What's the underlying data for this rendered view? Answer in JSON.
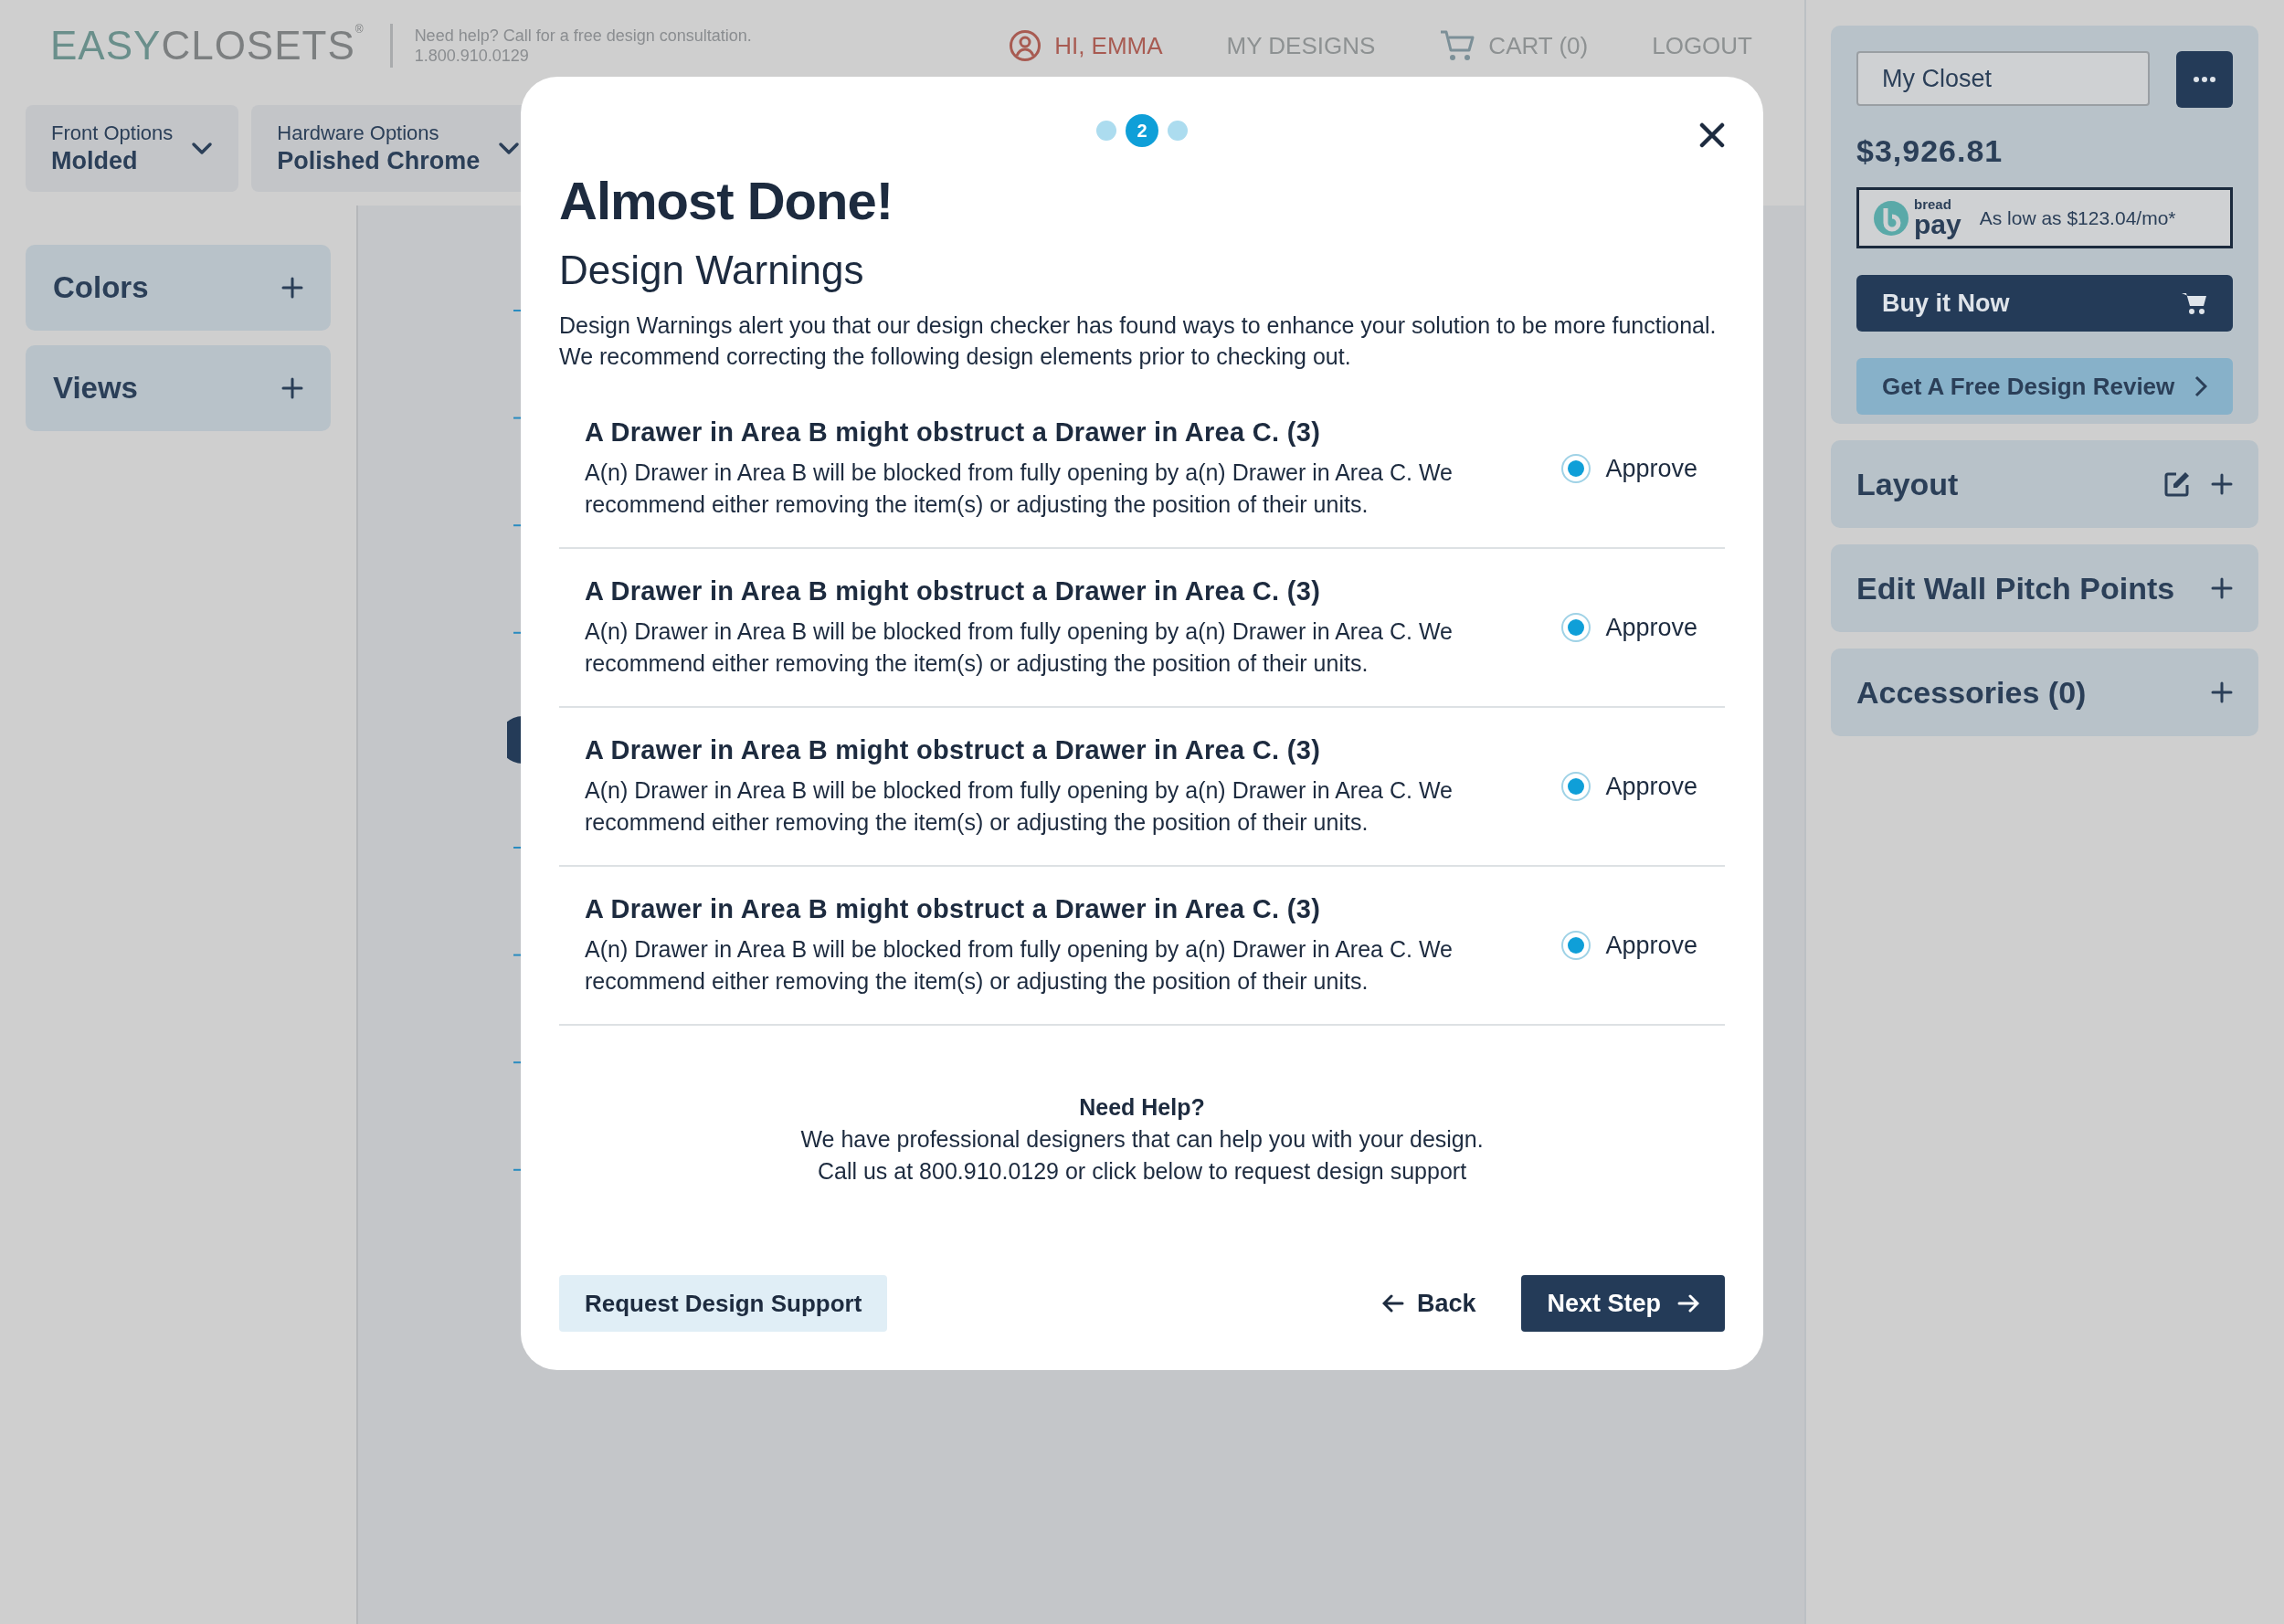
{
  "header": {
    "logo_accent": "EASY",
    "logo_rest": "CLOSETS",
    "logo_mark": "®",
    "tagline": "Need help? Call for a free design consultation.",
    "phone": "1.800.910.0129",
    "nav": [
      {
        "label": "HI, EMMA",
        "kind": "user"
      },
      {
        "label": "MY DESIGNS",
        "kind": "link"
      },
      {
        "label": "CART (0)",
        "kind": "cart"
      },
      {
        "label": "LOGOUT",
        "kind": "link"
      }
    ]
  },
  "options": [
    {
      "label": "Front Options",
      "value": "Molded"
    },
    {
      "label": "Hardware Options",
      "value": "Polished Chrome"
    }
  ],
  "left_panels": [
    "Colors",
    "Views"
  ],
  "summary": {
    "design_name": "My Closet",
    "price": "$3,926.81",
    "financing": {
      "brand_top": "bread",
      "brand": "pay",
      "text": "As low as $123.04/mo*"
    },
    "buy_button": "Buy it Now",
    "review_button": "Get A Free Design Review"
  },
  "right_panels": [
    {
      "label": "Layout",
      "editable": true
    },
    {
      "label": "Edit Wall Pitch Points",
      "editable": false
    },
    {
      "label": "Accessories (0)",
      "editable": false
    }
  ],
  "modal": {
    "steps": [
      {
        "selected": false
      },
      {
        "selected": true,
        "label": "2"
      },
      {
        "selected": false
      }
    ],
    "title": "Almost Done!",
    "subtitle": "Design Warnings",
    "intro": "Design Warnings alert you that our design checker has found ways to enhance your solution to be more functional. We recommend correcting the following design elements prior to checking out.",
    "warnings": [
      {
        "title": "A Drawer in Area B might obstruct a Drawer in Area C. (3)",
        "description": "A(n) Drawer in Area B will be blocked from fully opening by a(n) Drawer in Area C. We recommend either removing the item(s) or adjusting the position of their units.",
        "option": "Approve",
        "selected": true
      },
      {
        "title": "A Drawer in Area B might obstruct a Drawer in Area C. (3)",
        "description": "A(n) Drawer in Area B will be blocked from fully opening by a(n) Drawer in Area C. We recommend either removing the item(s) or adjusting the position of their units.",
        "option": "Approve",
        "selected": true
      },
      {
        "title": "A Drawer in Area B might obstruct a Drawer in Area C. (3)",
        "description": "A(n) Drawer in Area B will be blocked from fully opening by a(n) Drawer in Area C. We recommend either removing the item(s) or adjusting the position of their units.",
        "option": "Approve",
        "selected": true
      },
      {
        "title": "A Drawer in Area B might obstruct a Drawer in Area C. (3)",
        "description": "A(n) Drawer in Area B will be blocked from fully opening by a(n) Drawer in Area C. We recommend either removing the item(s) or adjusting the position of their units.",
        "option": "Approve",
        "selected": true
      }
    ],
    "help": {
      "title": "Need Help?",
      "lines": [
        "We have professional designers that can help you with your design.",
        "Call us at 800.910.0129 or click below to request design support"
      ]
    },
    "support_button": "Request Design Support",
    "back_button": "Back",
    "next_button": "Next Step"
  }
}
